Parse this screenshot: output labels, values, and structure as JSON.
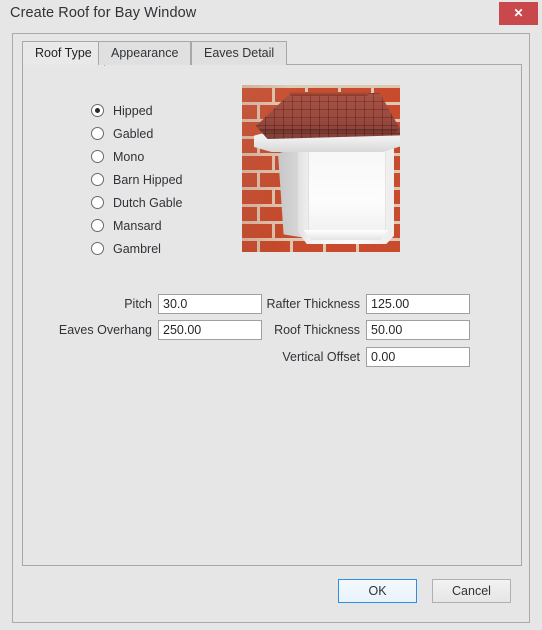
{
  "window": {
    "title": "Create Roof for Bay Window",
    "close_label": "✕",
    "close_icon": "close-icon",
    "close_color": "#c9484c"
  },
  "tabs": [
    {
      "label": "Roof Type",
      "active": true
    },
    {
      "label": "Appearance",
      "active": false
    },
    {
      "label": "Eaves Detail",
      "active": false
    }
  ],
  "roof_type": {
    "selected": "Hipped",
    "options": [
      {
        "label": "Hipped",
        "selected": true
      },
      {
        "label": "Gabled",
        "selected": false
      },
      {
        "label": "Mono",
        "selected": false
      },
      {
        "label": "Barn Hipped",
        "selected": false
      },
      {
        "label": "Dutch Gable",
        "selected": false
      },
      {
        "label": "Mansard",
        "selected": false
      },
      {
        "label": "Gambrel",
        "selected": false
      }
    ]
  },
  "preview": {
    "name": "roof-preview-image",
    "description": "Hipped roof bay window on brick wall",
    "roof_color": "#8e3428",
    "brick_color": "#c74b2c",
    "mortar_color": "#ded0ba",
    "window_color": "#f4f4f4"
  },
  "fields": {
    "pitch": {
      "label": "Pitch",
      "value": "30.0"
    },
    "eaves_overhang": {
      "label": "Eaves Overhang",
      "value": "250.00"
    },
    "rafter_thickness": {
      "label": "Rafter Thickness",
      "value": "125.00"
    },
    "roof_thickness": {
      "label": "Roof Thickness",
      "value": "50.00"
    },
    "vertical_offset": {
      "label": "Vertical Offset",
      "value": "0.00"
    }
  },
  "footer": {
    "ok_label": "OK",
    "cancel_label": "Cancel",
    "focus_color": "#2f8de4"
  }
}
